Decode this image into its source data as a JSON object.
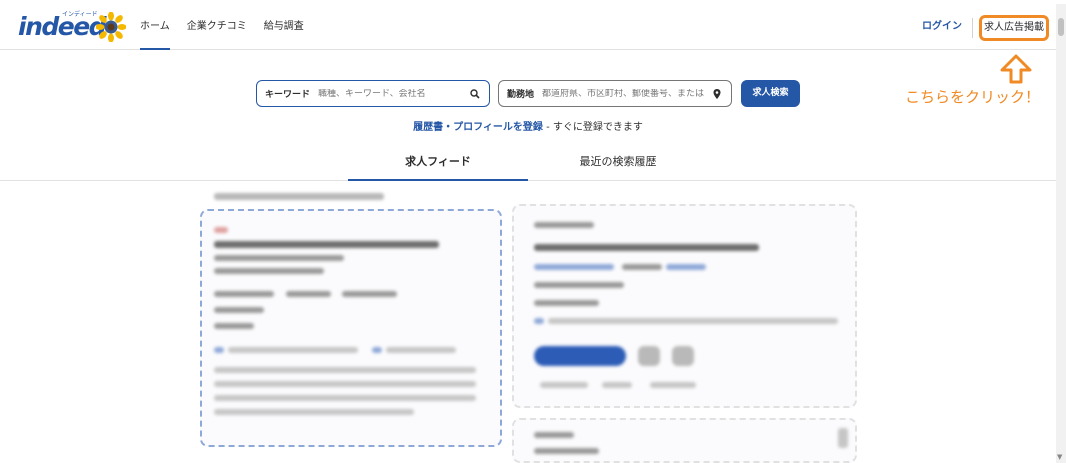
{
  "brand": {
    "logo_text": "indeed",
    "logo_kana": "インディード"
  },
  "nav": {
    "items": [
      {
        "label": "ホーム"
      },
      {
        "label": "企業クチコミ"
      },
      {
        "label": "給与調査"
      }
    ]
  },
  "header_right": {
    "login_label": "ログイン",
    "employer_label": "求人広告掲載"
  },
  "annotation": {
    "note": "こちらをクリック！",
    "color": "#f08a24"
  },
  "search": {
    "what_label": "キーワード",
    "what_placeholder": "職種、キーワード、会社名",
    "where_label": "勤務地",
    "where_placeholder": "都道府県、市区町村、郵便番号、または",
    "button_label": "求人検索"
  },
  "resume": {
    "link_text": "履歴書・プロフィールを登録",
    "rest_text": " - すぐに登録できます"
  },
  "tabs": [
    {
      "label": "求人フィード"
    },
    {
      "label": "最近の検索履歴"
    }
  ],
  "colors": {
    "brand_blue": "#2557a7",
    "accent_orange": "#f08a24"
  }
}
